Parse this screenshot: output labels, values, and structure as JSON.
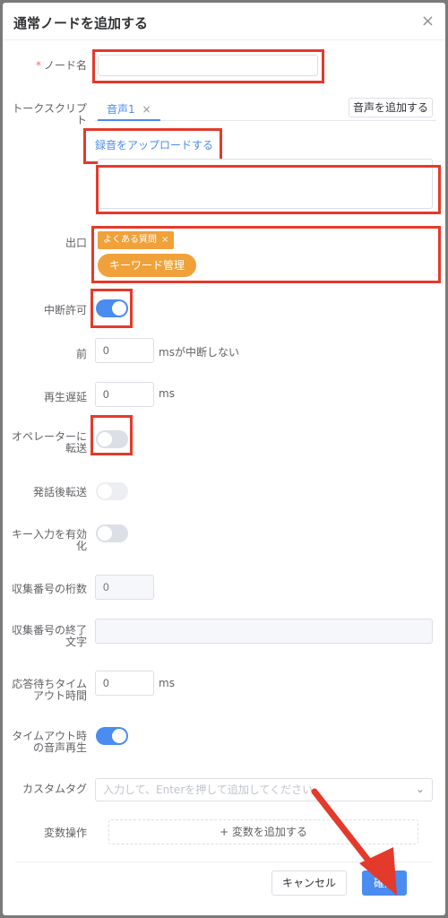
{
  "dialog": {
    "title": "通常ノードを追加する",
    "close_icon": "×"
  },
  "form": {
    "node_name": {
      "label": "ノード名",
      "required_mark": "*",
      "value": ""
    },
    "talk_script": {
      "label": "トークスクリプト",
      "tab_label": "音声1",
      "tab_close": "×",
      "add_voice_button": "音声を追加する",
      "upload_link": "録音をアップロードする",
      "text_value": ""
    },
    "exit": {
      "label": "出口",
      "tag_label": "よくある質問",
      "tag_close": "×",
      "keyword_button": "キーワード管理"
    },
    "interrupt": {
      "label": "中断許可",
      "enabled": true
    },
    "before": {
      "label": "前",
      "value": "0",
      "unit": "msが中断しない"
    },
    "playback_delay": {
      "label": "再生遅延",
      "value": "0",
      "unit": "ms"
    },
    "transfer_operator": {
      "label": "オペレーターに転送",
      "enabled": false
    },
    "transfer_after": {
      "label": "発話後転送",
      "enabled": false,
      "disabled": true
    },
    "key_input": {
      "label": "キー入力を有効化",
      "enabled": false
    },
    "collect_digits": {
      "label": "収集番号の桁数",
      "placeholder": "0"
    },
    "collect_end_char": {
      "label": "収集番号の終了文字",
      "value": ""
    },
    "response_timeout": {
      "label": "応答待ちタイムアウト時間",
      "value": "0",
      "unit": "ms"
    },
    "timeout_playback": {
      "label": "タイムアウト時の音声再生",
      "enabled": true
    },
    "custom_tag": {
      "label": "カスタムタグ",
      "placeholder": "入力して、Enterを押して追加してください"
    },
    "variable_op": {
      "label": "変数操作",
      "add_button": "+ 変数を追加する"
    }
  },
  "footer": {
    "cancel_label": "キャンセル",
    "confirm_label": "確定"
  },
  "colors": {
    "accent": "#4a8cf0",
    "highlight": "#e43a2b",
    "tag": "#f0a13a"
  }
}
